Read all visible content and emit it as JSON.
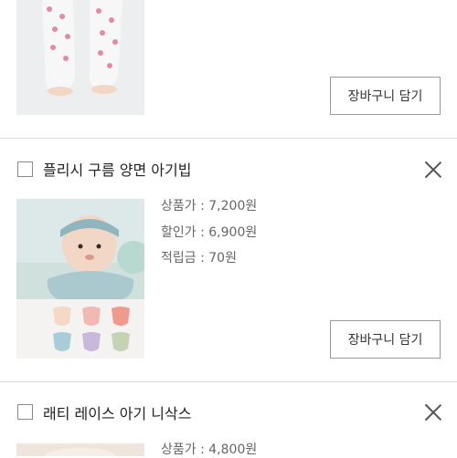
{
  "products": [
    {
      "title": "",
      "cart_button": "장바구니 담기"
    },
    {
      "title": "플리시 구름 양면 아기빕",
      "prices": [
        {
          "label": "상품가",
          "value": "7,200원"
        },
        {
          "label": "할인가",
          "value": "6,900원"
        },
        {
          "label": "적립금",
          "value": "70원"
        }
      ],
      "cart_button": "장바구니 담기"
    },
    {
      "title": "래티 레이스 아기 니삭스",
      "prices": [
        {
          "label": "상품가",
          "value": "4,800원"
        }
      ]
    }
  ],
  "colors": {
    "divider": "#dcdcdc",
    "button_border": "#9a9a9a",
    "text": "#222222",
    "secondary_text": "#666666"
  }
}
